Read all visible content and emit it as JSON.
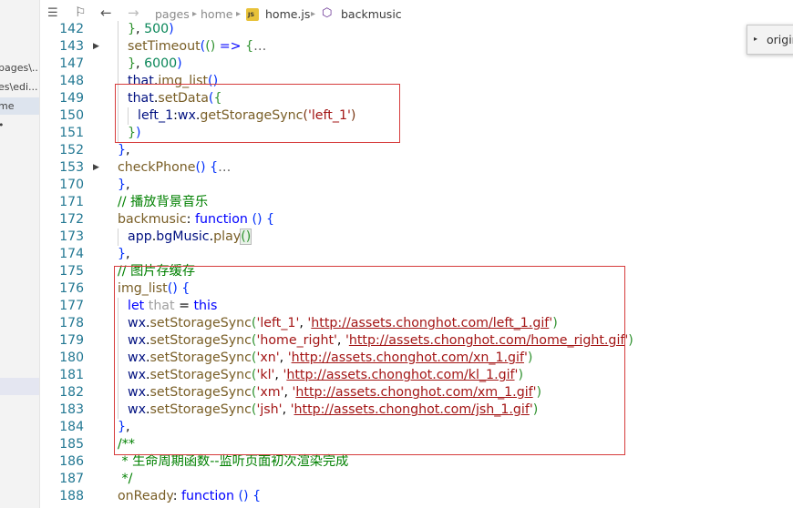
{
  "explorer": {
    "rows": [
      "pages\\...",
      "es\\edi...",
      "me",
      "•"
    ]
  },
  "breadcrumb": {
    "segments": [
      "pages",
      "home",
      "home.js",
      "backmusic"
    ]
  },
  "hover": {
    "text": "origin"
  },
  "code": {
    "line_numbers": [
      "142",
      "143",
      "147",
      "148",
      "149",
      "150",
      "151",
      "152",
      "153",
      "170",
      "171",
      "172",
      "173",
      "174",
      "175",
      "176",
      "177",
      "178",
      "179",
      "180",
      "181",
      "182",
      "183",
      "184",
      "185",
      "186",
      "187",
      "188"
    ],
    "comments": {
      "play_bg": "// 播放背景音乐",
      "img_cache": "// 图片存缓存",
      "lifecycle": "* 生命周期函数--监听页面初次渲染完成"
    },
    "strings": {
      "left_1": "'left_1'",
      "home_right": "'home_right'",
      "xn": "'xn'",
      "kl": "'kl'",
      "xm": "'xm'",
      "jsh": "'jsh'",
      "url_left": "http://assets.chonghot.com/left_1.gif",
      "url_home_right": "http://assets.chonghot.com/home_right.gif",
      "url_xn": "http://assets.chonghot.com/xn_1.gif",
      "url_kl": "http://assets.chonghot.com/kl_1.gif",
      "url_xm": "http://assets.chonghot.com/xm_1.gif",
      "url_jsh": "http://assets.chonghot.com/jsh_1.gif"
    }
  },
  "colors": {
    "annotation": "#d63c3c",
    "line_number": "#237893",
    "keyword": "#0000ff",
    "function": "#795e26",
    "string": "#a31515",
    "comment": "#008000"
  }
}
